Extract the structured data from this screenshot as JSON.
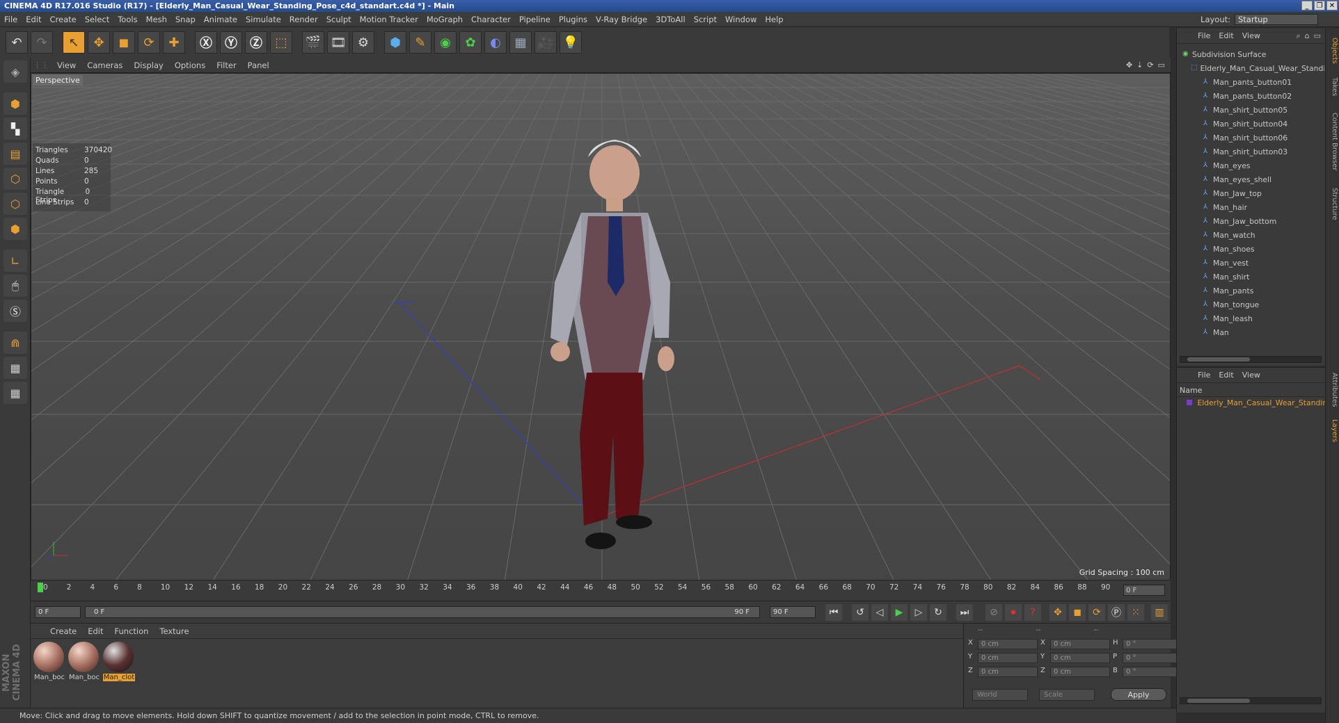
{
  "window": {
    "title": "CINEMA 4D R17.016 Studio (R17) - [Elderly_Man_Casual_Wear_Standing_Pose_c4d_standart.c4d *] - Main"
  },
  "menubar": {
    "items": [
      "File",
      "Edit",
      "Create",
      "Select",
      "Tools",
      "Mesh",
      "Snap",
      "Animate",
      "Simulate",
      "Render",
      "Sculpt",
      "Motion Tracker",
      "MoGraph",
      "Character",
      "Pipeline",
      "Plugins",
      "V-Ray Bridge",
      "3DToAll",
      "Script",
      "Window",
      "Help"
    ]
  },
  "layout": {
    "label": "Layout:",
    "value": "Startup"
  },
  "viewport": {
    "menu": [
      "View",
      "Cameras",
      "Display",
      "Options",
      "Filter",
      "Panel"
    ],
    "camera_label": "Perspective",
    "grid_spacing": "Grid Spacing : 100 cm",
    "stats": [
      {
        "label": "Triangles",
        "value": "370420"
      },
      {
        "label": "Quads",
        "value": "0"
      },
      {
        "label": "Lines",
        "value": "285"
      },
      {
        "label": "Points",
        "value": "0"
      },
      {
        "label": "Triangle Strips",
        "value": "0"
      },
      {
        "label": "Line Strips",
        "value": "0"
      }
    ]
  },
  "timeline": {
    "ticks": [
      "0",
      "2",
      "4",
      "6",
      "8",
      "10",
      "12",
      "14",
      "16",
      "18",
      "20",
      "22",
      "24",
      "26",
      "28",
      "30",
      "32",
      "34",
      "36",
      "38",
      "40",
      "42",
      "44",
      "46",
      "48",
      "50",
      "52",
      "54",
      "56",
      "58",
      "60",
      "62",
      "64",
      "66",
      "68",
      "70",
      "72",
      "74",
      "76",
      "78",
      "80",
      "82",
      "84",
      "86",
      "88",
      "90"
    ],
    "current_frame": "0 F"
  },
  "transport": {
    "start_field": "0 F",
    "range_start": "0 F",
    "range_end": "90 F",
    "end_field": "90 F"
  },
  "materials": {
    "menu": [
      "Create",
      "Edit",
      "Function",
      "Texture"
    ],
    "items": [
      {
        "name": "Man_boc",
        "selected": false
      },
      {
        "name": "Man_boc",
        "selected": false
      },
      {
        "name": "Man_clot",
        "selected": true
      }
    ]
  },
  "coordinates": {
    "headers": [
      "--",
      "--",
      "--"
    ],
    "rows": [
      {
        "l1": "X",
        "v1": "0 cm",
        "l2": "X",
        "v2": "0 cm",
        "l3": "H",
        "v3": "0 °"
      },
      {
        "l1": "Y",
        "v1": "0 cm",
        "l2": "Y",
        "v2": "0 cm",
        "l3": "P",
        "v3": "0 °"
      },
      {
        "l1": "Z",
        "v1": "0 cm",
        "l2": "Z",
        "v2": "0 cm",
        "l3": "B",
        "v3": "0 °"
      }
    ],
    "mode_world": "World",
    "mode_scale": "Scale",
    "apply": "Apply"
  },
  "status": {
    "text": "Move: Click and drag to move elements. Hold down SHIFT to quantize movement / add to the selection in point mode, CTRL to remove."
  },
  "brand": {
    "text": "MAXON CINEMA 4D"
  },
  "objects": {
    "menu": [
      "File",
      "Edit",
      "View"
    ],
    "root": "Subdivision Surface",
    "group": "Elderly_Man_Casual_Wear_Standin",
    "children": [
      "Man_pants_button01",
      "Man_pants_button02",
      "Man_shirt_button05",
      "Man_shirt_button04",
      "Man_shirt_button06",
      "Man_shirt_button03",
      "Man_eyes",
      "Man_eyes_shell",
      "Man_Jaw_top",
      "Man_hair",
      "Man_Jaw_bottom",
      "Man_watch",
      "Man_shoes",
      "Man_vest",
      "Man_shirt",
      "Man_pants",
      "Man_tongue",
      "Man_leash",
      "Man"
    ]
  },
  "layers": {
    "menu": [
      "File",
      "Edit",
      "View"
    ],
    "header": "Name",
    "item": "Elderly_Man_Casual_Wear_Standing"
  },
  "sidetabs": {
    "objects": "Objects",
    "takes": "Takes",
    "content": "Content Browser",
    "structure": "Structure",
    "attributes": "Attributes",
    "layers": "Layers"
  }
}
